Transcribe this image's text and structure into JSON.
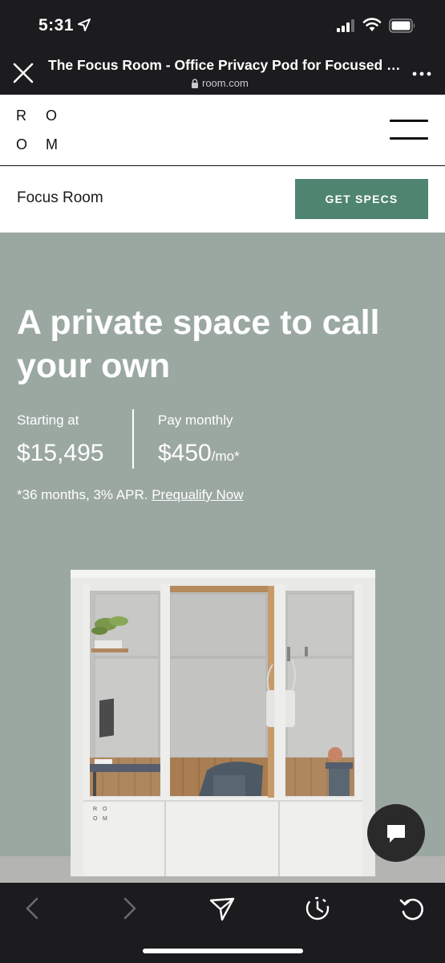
{
  "status_bar": {
    "time": "5:31"
  },
  "browser": {
    "title": "The Focus Room - Office Privacy Pod for Focused Work",
    "url": "room.com"
  },
  "site_header": {
    "logo_letters": [
      "R",
      "O",
      "O",
      "M"
    ]
  },
  "sub_header": {
    "product_name": "Focus Room",
    "cta_label": "GET SPECS"
  },
  "hero": {
    "headline": "A private space to call your own",
    "price_start": {
      "label": "Starting at",
      "value": "$15,495"
    },
    "price_monthly": {
      "label": "Pay monthly",
      "value": "$450",
      "unit": "/mo*"
    },
    "apr_text": "*36 months, 3% APR. ",
    "apr_link": "Prequalify Now",
    "pod_logo_letters": [
      "R",
      "O",
      "O",
      "M"
    ]
  },
  "colors": {
    "accent": "#4f8470",
    "hero_bg": "#9ba8a1",
    "chrome_bg": "#1c1c1e"
  },
  "toolbar": {
    "icons": [
      "back-icon",
      "forward-icon",
      "share-icon",
      "history-icon",
      "reload-icon"
    ]
  }
}
